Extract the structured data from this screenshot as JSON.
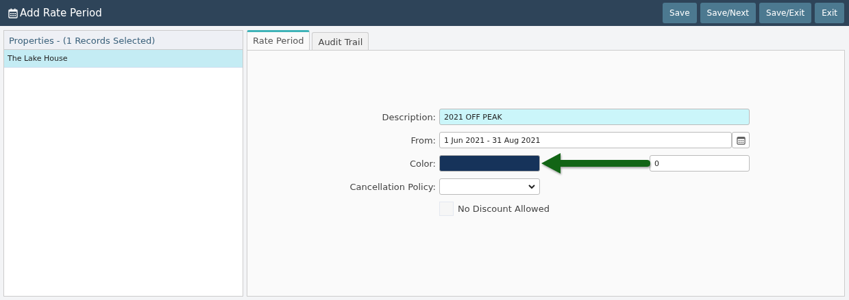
{
  "window": {
    "title": "Add Rate Period"
  },
  "buttons": [
    {
      "label": "Save"
    },
    {
      "label": "Save/Next"
    },
    {
      "label": "Save/Exit"
    },
    {
      "label": "Exit"
    }
  ],
  "properties": {
    "heading": "Properties - (1 Records Selected)",
    "items": [
      {
        "label": "The Lake House",
        "selected": true
      }
    ]
  },
  "tabs": [
    {
      "label": "Rate Period",
      "selected": true
    },
    {
      "label": "Audit Trail",
      "selected": false
    }
  ],
  "form": {
    "description": {
      "label": "Description:",
      "value": "2021 OFF PEAK"
    },
    "from": {
      "label": "From:",
      "value": "1 Jun 2021 - 31 Aug 2021"
    },
    "color": {
      "label": "Color:",
      "color": "#16335a"
    },
    "min_per_period": {
      "value": "0"
    },
    "cancellation_policy": {
      "label": "Cancellation Policy:"
    },
    "no_discount": {
      "label": "No Discount Allowed",
      "checked": false
    }
  }
}
